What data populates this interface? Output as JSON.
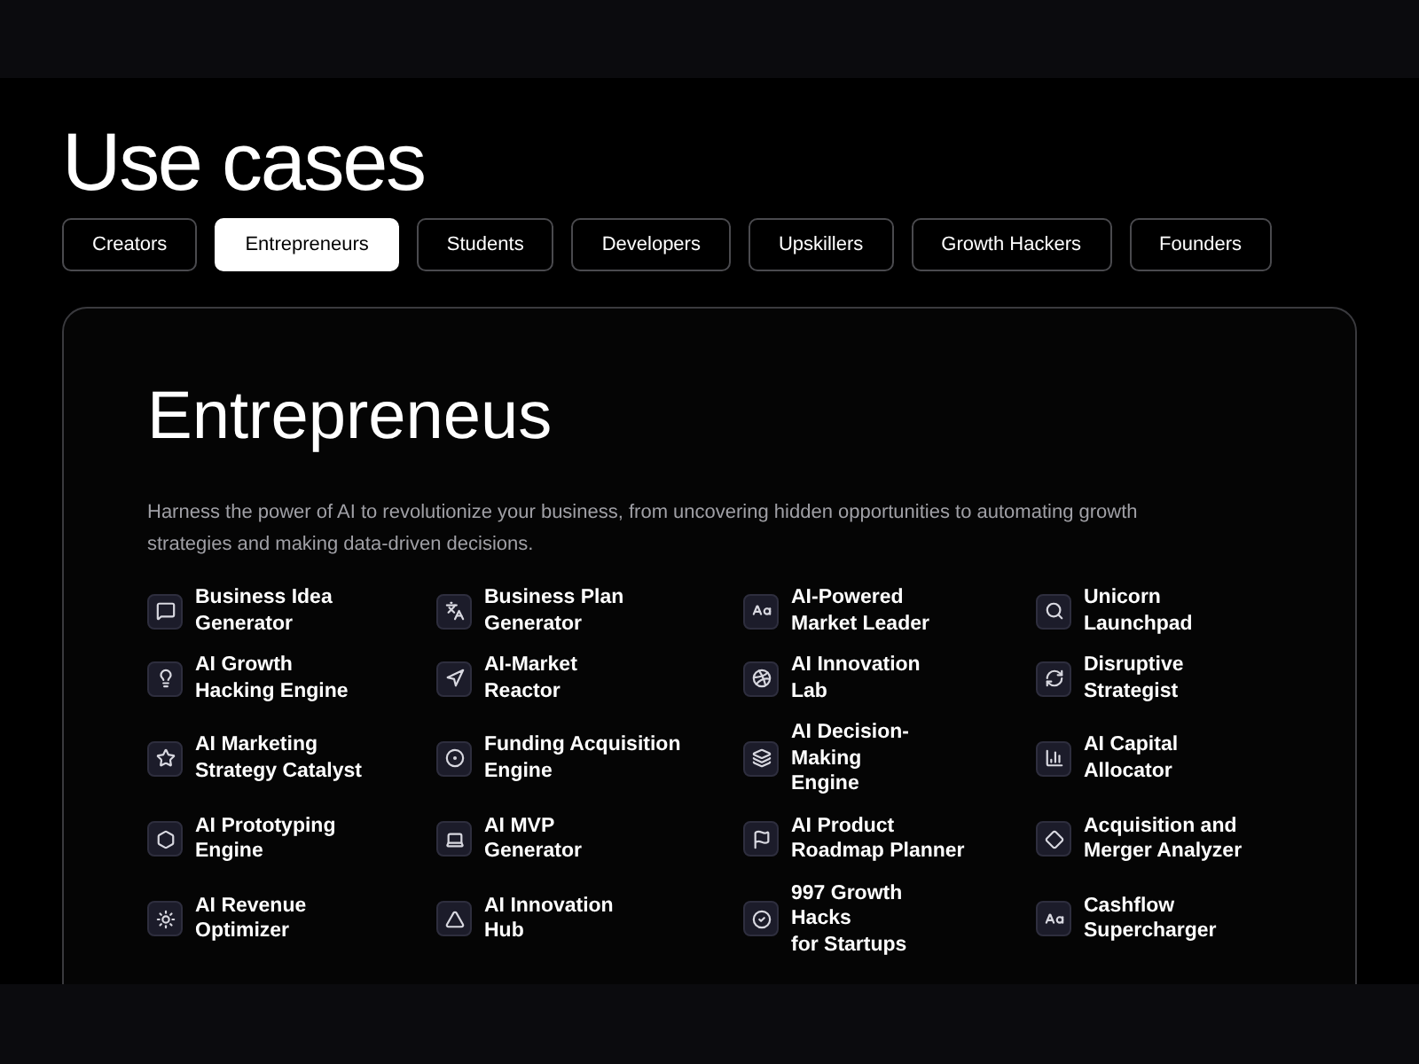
{
  "title": "Use cases",
  "tabs": [
    {
      "label": "Creators",
      "selected": false
    },
    {
      "label": "Entrepreneurs",
      "selected": true
    },
    {
      "label": "Students",
      "selected": false
    },
    {
      "label": "Developers",
      "selected": false
    },
    {
      "label": "Upskillers",
      "selected": false
    },
    {
      "label": "Growth Hackers",
      "selected": false
    },
    {
      "label": "Founders",
      "selected": false
    }
  ],
  "panel": {
    "heading": "Entrepreneus",
    "description": "Harness the power of AI to revolutionize your business, from uncovering hidden opportunities to automating growth strategies and making data-driven decisions.",
    "items": [
      {
        "label": "Business Idea\nGenerator"
      },
      {
        "label": "Business Plan\nGenerator"
      },
      {
        "label": "AI-Powered\nMarket Leader"
      },
      {
        "label": "Unicorn\nLaunchpad"
      },
      {
        "label": "AI Growth\nHacking Engine"
      },
      {
        "label": "AI-Market\nReactor"
      },
      {
        "label": "AI Innovation\nLab"
      },
      {
        "label": "Disruptive\nStrategist"
      },
      {
        "label": "AI Marketing\nStrategy Catalyst"
      },
      {
        "label": "Funding Acquisition\nEngine"
      },
      {
        "label": "AI Decision-\nMaking\nEngine"
      },
      {
        "label": "AI Capital\nAllocator"
      },
      {
        "label": "AI Prototyping\nEngine"
      },
      {
        "label": "AI MVP\nGenerator"
      },
      {
        "label": "AI Product\nRoadmap Planner"
      },
      {
        "label": "Acquisition and\nMerger Analyzer"
      },
      {
        "label": "AI Revenue\nOptimizer"
      },
      {
        "label": "AI Innovation\nHub"
      },
      {
        "label": "997 Growth\nHacks\nfor Startups"
      },
      {
        "label": "Cashflow\nSupercharger"
      }
    ]
  }
}
